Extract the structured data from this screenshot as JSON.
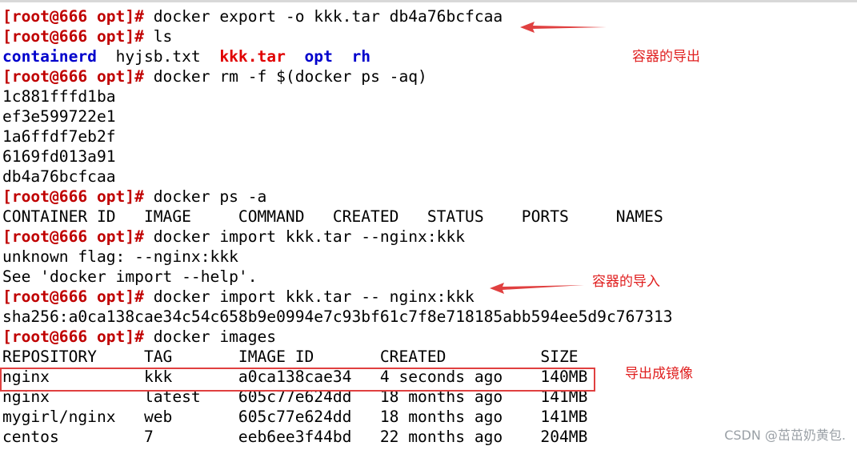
{
  "colors": {
    "prompt": "#c00000",
    "directory": "#0000cc",
    "archive": "#e00000",
    "annotation": "#e02020",
    "highlight": "#e04040"
  },
  "terminal": {
    "lines": [
      {
        "prompt": "[root@666 opt]#",
        "text": " docker export -o kkk.tar db4a76bcfcaa"
      },
      {
        "prompt": "[root@666 opt]#",
        "text": " ls"
      },
      {
        "ls": [
          {
            "name": "containerd",
            "kind": "dir"
          },
          {
            "name": "hyjsb.txt",
            "kind": "file"
          },
          {
            "name": "kkk.tar",
            "kind": "archive"
          },
          {
            "name": "opt",
            "kind": "dir"
          },
          {
            "name": "rh",
            "kind": "dir"
          }
        ]
      },
      {
        "prompt": "[root@666 opt]#",
        "text": " docker rm -f $(docker ps -aq)"
      },
      {
        "text": "1c881fffd1ba"
      },
      {
        "text": "ef3e599722e1"
      },
      {
        "text": "1a6ffdf7eb2f"
      },
      {
        "text": "6169fd013a91"
      },
      {
        "text": "db4a76bcfcaa"
      },
      {
        "prompt": "[root@666 opt]#",
        "text": " docker ps -a"
      },
      {
        "text": "CONTAINER ID   IMAGE     COMMAND   CREATED   STATUS    PORTS     NAMES"
      },
      {
        "prompt": "[root@666 opt]#",
        "text": " docker import kkk.tar --nginx:kkk"
      },
      {
        "text": "unknown flag: --nginx:kkk"
      },
      {
        "text": "See 'docker import --help'."
      },
      {
        "prompt": "[root@666 opt]#",
        "text": " docker import kkk.tar -- nginx:kkk"
      },
      {
        "text": "sha256:a0ca138cae34c54c658b9e0994e7c93bf61c7f8e718185abb594ee5d9c767313"
      },
      {
        "prompt": "[root@666 opt]#",
        "text": " docker images"
      },
      {
        "text": "REPOSITORY     TAG       IMAGE ID       CREATED          SIZE"
      },
      {
        "text": "nginx          kkk       a0ca138cae34   4 seconds ago    140MB"
      },
      {
        "text": "nginx          latest    605c77e624dd   18 months ago    141MB"
      },
      {
        "text": "mygirl/nginx   web       605c77e624dd   18 months ago    141MB"
      },
      {
        "text": "centos         7         eeb6ee3f44bd   22 months ago    204MB"
      }
    ]
  },
  "annotations": {
    "export": "容器的导出",
    "import": "容器的导入",
    "to_image": "导出成镜像"
  },
  "watermark": "CSDN @茁茁奶黄包."
}
